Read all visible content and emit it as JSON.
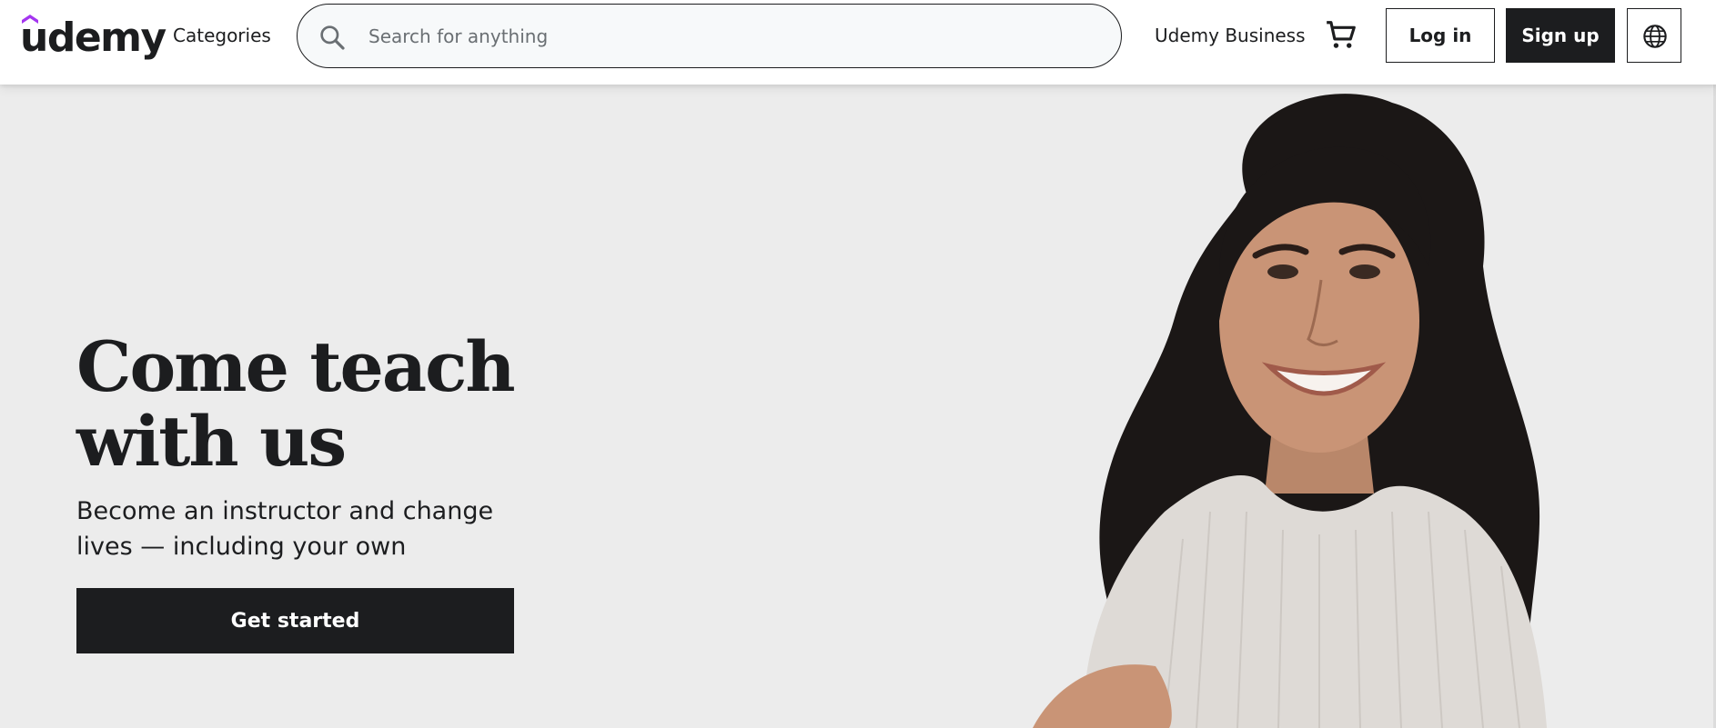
{
  "header": {
    "logo_text": "udemy",
    "categories_label": "Categories",
    "search": {
      "placeholder": "Search for anything",
      "value": ""
    },
    "business_label": "Udemy Business",
    "login_label": "Log in",
    "signup_label": "Sign up",
    "icons": {
      "search": "search-icon",
      "cart": "cart-icon",
      "language": "globe-icon"
    }
  },
  "hero": {
    "title_line1": "Come teach",
    "title_line2": "with us",
    "subtitle": "Become an instructor and change lives — including your own",
    "cta_label": "Get started"
  },
  "colors": {
    "brand_accent": "#a435f0",
    "text_dark": "#1c1d1f",
    "hero_bg": "#ececec"
  }
}
